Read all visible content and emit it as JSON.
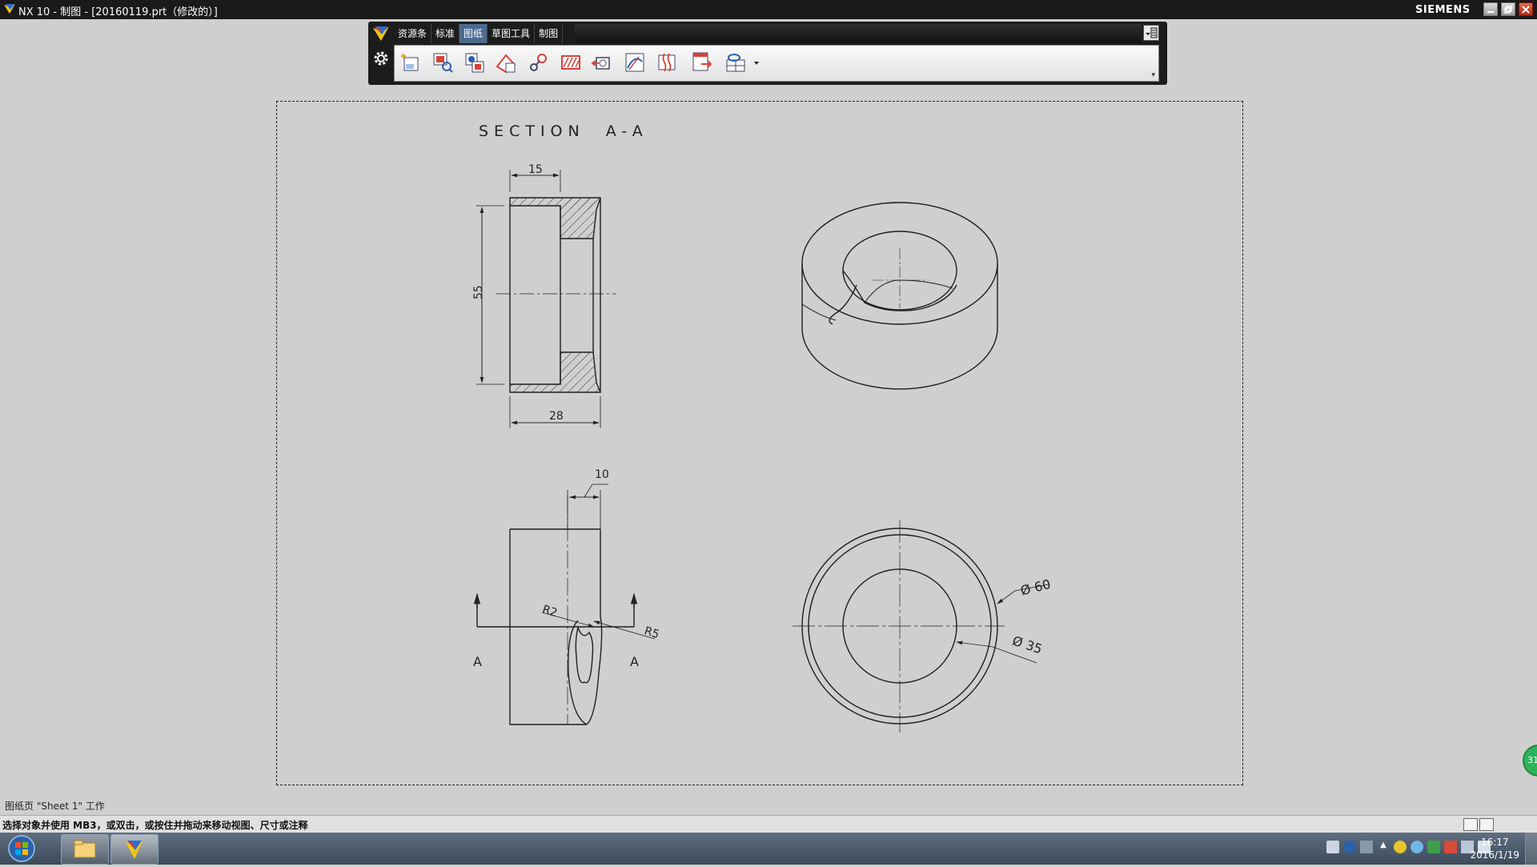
{
  "window": {
    "title": "NX 10 - 制图 - [20160119.prt（修改的）]",
    "brand": "SIEMENS"
  },
  "ribbon": {
    "tabs": [
      "资源条",
      "标准",
      "图纸",
      "草图工具",
      "制图"
    ],
    "active_tab": "图纸",
    "tools": [
      "new-sheet-icon",
      "base-view-icon",
      "projected-view-icon",
      "detail-view-icon",
      "section-line-icon",
      "section-view-icon",
      "half-section-icon",
      "revolved-section-icon",
      "break-view-icon",
      "update-views-icon",
      "view-display-icon"
    ]
  },
  "drawing": {
    "section_label": "SECTION  A-A",
    "dims": {
      "d15": "15",
      "d55": "55",
      "d28": "28",
      "d10": "10",
      "r2": "R2",
      "r5": "R5",
      "phi60": "Ø 60",
      "phi35": "Ø 35",
      "cut_left": "A",
      "cut_right": "A"
    }
  },
  "status": {
    "sheet_line": "图纸页 \"Sheet 1\" 工作",
    "prompt": "选择对象并使用 MB3，或双击，或按住并拖动来移动视图、尺寸或注释"
  },
  "taskbar": {
    "time": "16:17",
    "date": "2016/1/19",
    "badge": "31"
  },
  "colors": {
    "background": "#cfcfcf",
    "active_tab": "#4d6b8e",
    "line": "#1e1e1e"
  }
}
